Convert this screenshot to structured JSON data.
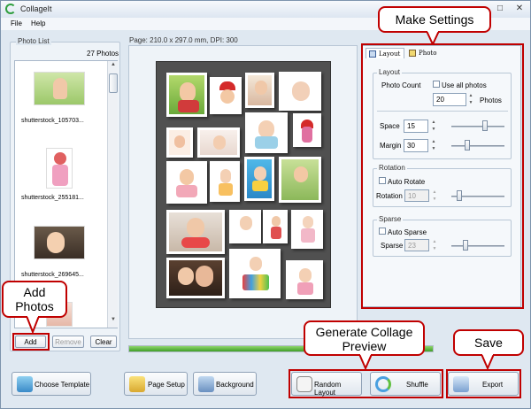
{
  "app": {
    "title": "CollageIt"
  },
  "menu": [
    "File",
    "Help"
  ],
  "photo_list": {
    "title": "Photo List",
    "count": "27 Photos",
    "items": [
      "shutterstock_105703...",
      "shutterstock_255181...",
      "shutterstock_269645..."
    ],
    "add_label": "Add",
    "remove_label": "Remove",
    "clear_label": "Clear"
  },
  "page_info": "Page: 210.0 x 297.0 mm, DPI: 300",
  "tabs": {
    "layout": "Layout",
    "photo": "Photo"
  },
  "layout_group": {
    "title": "Layout",
    "photo_count_label": "Photo Count",
    "use_all_label": "Use all photos",
    "photo_count_value": "20",
    "photos_unit": "Photos",
    "space_label": "Space",
    "space_value": "15",
    "margin_label": "Margin",
    "margin_value": "30"
  },
  "rotation_group": {
    "title": "Rotation",
    "auto_label": "Auto Rotate",
    "field_label": "Rotation",
    "value": "10"
  },
  "sparse_group": {
    "title": "Sparse",
    "auto_label": "Auto Sparse",
    "field_label": "Sparse",
    "value": "23"
  },
  "bottom_buttons": {
    "choose_template": "Choose Template",
    "page_setup": "Page Setup",
    "background": "Background",
    "random_layout": "Random Layout",
    "shuffle": "Shuffle",
    "export": "Export"
  },
  "callouts": {
    "make_settings": "Make Settings",
    "add_photos": "Add Photos",
    "generate_preview": "Generate Collage Preview",
    "save": "Save"
  },
  "colors": {
    "callout_border": "#c00000",
    "progress_green": "#4caf3a",
    "canvas_bg": "#4d4d4d"
  }
}
